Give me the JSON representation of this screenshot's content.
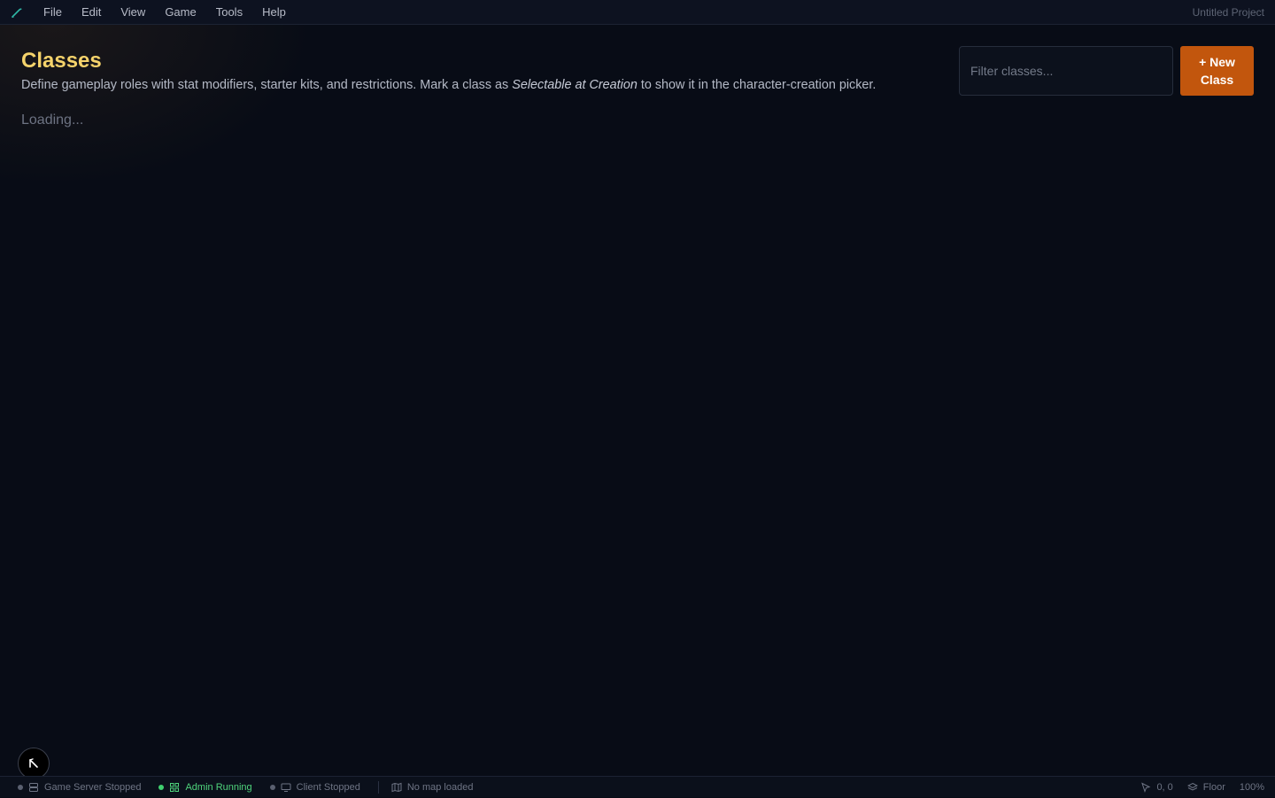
{
  "menubar": {
    "logo_icon": "pen-icon",
    "items": [
      "File",
      "Edit",
      "View",
      "Game",
      "Tools",
      "Help"
    ],
    "project_title": "Untitled Project"
  },
  "page": {
    "title": "Classes",
    "description_before": "Define gameplay roles with stat modifiers, starter kits, and restrictions. Mark a class as",
    "description_emphasis": "Selectable at Creation",
    "description_after": "to show it in the character-creation picker.",
    "filter_placeholder": "Filter classes...",
    "new_button_line1": "+ New",
    "new_button_line2": "Class",
    "loading_text": "Loading..."
  },
  "statusbar": {
    "game_server": "Game Server Stopped",
    "admin": "Admin Running",
    "client": "Client Stopped",
    "map": "No map loaded",
    "coords": "0, 0",
    "layer": "Floor",
    "zoom": "100%"
  },
  "colors": {
    "accent": "#c2560d",
    "title": "#f5d36b",
    "running": "#4fd47c",
    "background": "#080c16"
  }
}
